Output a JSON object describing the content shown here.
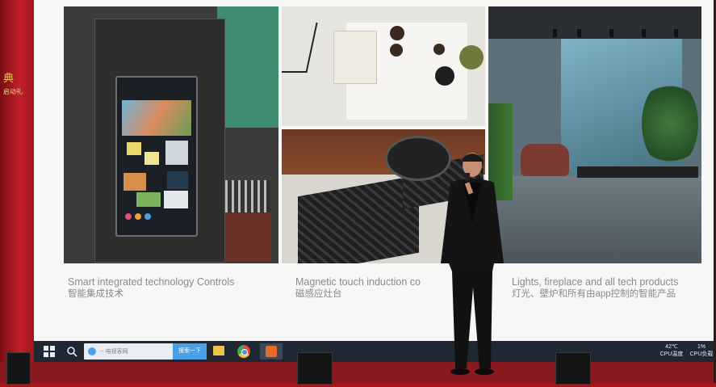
{
  "left_sign": {
    "main": "典",
    "sub": "启动礼"
  },
  "slide": {
    "captions": [
      {
        "en": "Smart integrated technology Controls",
        "zh": "智能集成技术"
      },
      {
        "en": "Magnetic touch induction co",
        "zh": "磁感应灶台"
      },
      {
        "en": "Lights, fireplace and all tech products",
        "zh": "灯光、壁炉和所有由app控制的智能产品"
      }
    ]
  },
  "taskbar": {
    "search_placeholder": "-- 电视客网",
    "button_label": "搜索一下",
    "tray": [
      {
        "value": "42℃",
        "label": "CPU温度"
      },
      {
        "value": "1%",
        "label": "CPU负载"
      }
    ]
  },
  "colors": {
    "curtain": "#a8161c",
    "taskbar": "#1f2733",
    "search_button": "#4aa0e6"
  },
  "icons": [
    "windows-start-icon",
    "search-icon",
    "file-explorer-icon",
    "chrome-icon",
    "app-icon"
  ]
}
